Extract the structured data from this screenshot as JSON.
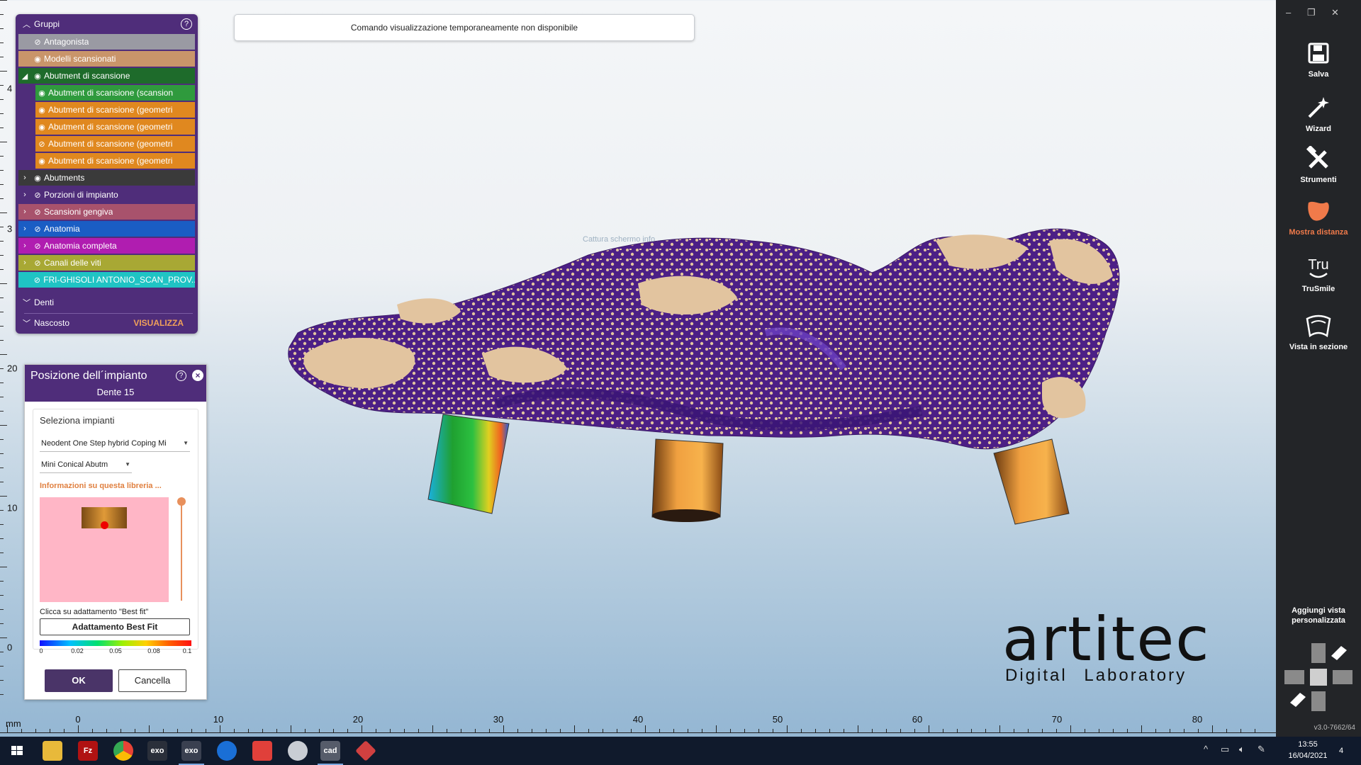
{
  "notice": "Comando visualizzazione temporaneamente non disponibile",
  "ghost_text": "Cattura schermo info",
  "ruler": {
    "unit": "mm",
    "left_labels": [
      "4",
      "3",
      "20",
      "10",
      "0"
    ],
    "bottom_labels": [
      "0",
      "10",
      "20",
      "30",
      "40",
      "50",
      "60",
      "70",
      "80"
    ]
  },
  "groups": {
    "title": "Gruppi",
    "items": [
      {
        "label": "Antagonista",
        "color": "#9a9aa3"
      },
      {
        "label": "Modelli scansionati",
        "color": "#c9956a"
      },
      {
        "label": "Abutment di scansione",
        "color": "#1e6b2b"
      },
      {
        "label": "Abutment di scansione (scansion",
        "color": "#2f9a3d"
      },
      {
        "label": "Abutment di scansione (geometri",
        "color": "#e0881f"
      },
      {
        "label": "Abutment di scansione (geometri",
        "color": "#e0881f"
      },
      {
        "label": "Abutment di scansione (geometri",
        "color": "#e0881f"
      },
      {
        "label": "Abutment di scansione (geometri",
        "color": "#e0881f"
      },
      {
        "label": "Abutments",
        "color": "#3a3a3a"
      },
      {
        "label": "Porzioni di impianto",
        "color": "#4f2d7a"
      },
      {
        "label": "Scansioni gengiva",
        "color": "#a8526c"
      },
      {
        "label": "Anatomia",
        "color": "#1a5dc4"
      },
      {
        "label": "Anatomia completa",
        "color": "#b01db0"
      },
      {
        "label": "Canali delle viti",
        "color": "#a8a834"
      },
      {
        "label": "FRI-GHISOLI ANTONIO_SCAN_PROV...",
        "color": "#1fc4c4"
      }
    ],
    "sections": [
      {
        "label": "Denti"
      },
      {
        "label": "Nascosto"
      }
    ],
    "visualize_label": "VISUALIZZA"
  },
  "implant_dialog": {
    "title": "Posizione dell´impianto",
    "subtitle": "Dente 15",
    "select_label": "Seleziona impianti",
    "implant_value": "Neodent One Step hybrid Coping Mi",
    "abutment_value": "Mini Conical Abutm",
    "library_info": "Informazioni su questa libreria ...",
    "hint": "Clicca su adattamento \"Best fit\"",
    "bestfit_button": "Adattamento Best Fit",
    "scale_labels": [
      "0",
      "0.02",
      "0.05",
      "0.08",
      "0.1"
    ],
    "ok_button": "OK",
    "cancel_button": "Cancella"
  },
  "toolbar": {
    "tools": [
      {
        "label": "Salva",
        "icon": "save-icon"
      },
      {
        "label": "Wizard",
        "icon": "wand-icon"
      },
      {
        "label": "Strumenti",
        "icon": "tools-icon"
      },
      {
        "label": "Mostra distanza",
        "icon": "distance-icon",
        "active_color": "#f07a4a"
      },
      {
        "label": "TruSmile",
        "icon": "trusmile-icon"
      },
      {
        "label": "Vista in sezione",
        "icon": "section-icon"
      }
    ],
    "custom_view": "Aggiungi vista personalizzata",
    "version": "v3.0-7662/64"
  },
  "logo": {
    "word": "artitec",
    "tagline": "Digital Laboratory"
  },
  "taskbar": {
    "apps": [
      "windows-icon",
      "file-explorer-icon",
      "filezilla-icon",
      "chrome-icon",
      "exo-icon",
      "exo-icon",
      "teamviewer-icon",
      "anydesk-icon",
      "scan-icon",
      "cad-icon",
      "3d-icon"
    ],
    "exo_label": "exo",
    "cad_label": "cad",
    "fz_label": "Fz",
    "time": "13:55",
    "date": "16/04/2021",
    "notifications": "4"
  }
}
